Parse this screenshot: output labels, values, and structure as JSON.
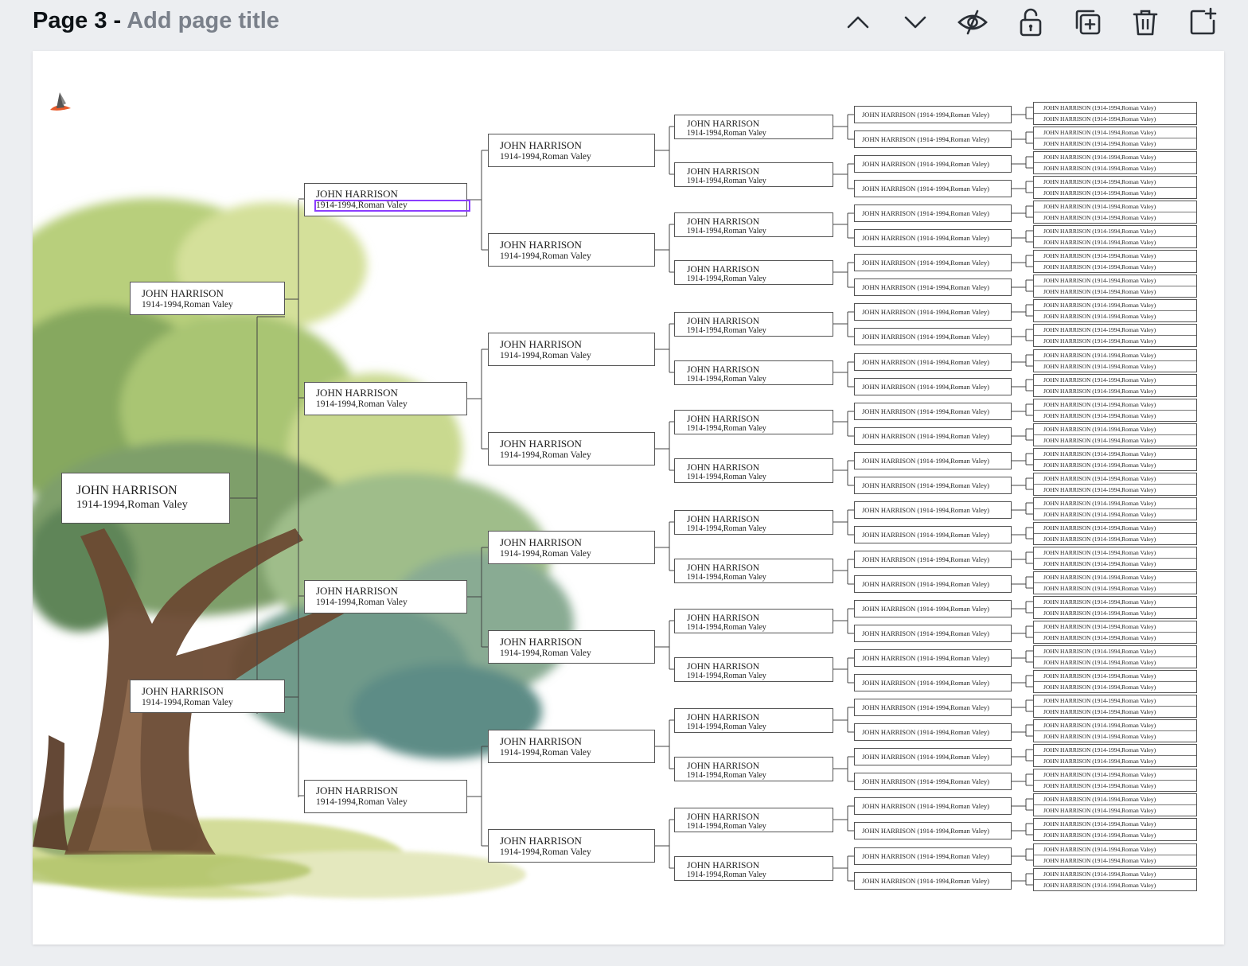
{
  "header": {
    "page_number": "Page 3",
    "separator": " - ",
    "title_placeholder": "Add page title"
  },
  "toolbar": [
    {
      "name": "move-up-icon"
    },
    {
      "name": "move-down-icon"
    },
    {
      "name": "hide-page-icon"
    },
    {
      "name": "lock-page-icon"
    },
    {
      "name": "duplicate-page-icon"
    },
    {
      "name": "delete-page-icon"
    },
    {
      "name": "add-page-icon"
    }
  ],
  "person": {
    "name": "JOHN HARRISON",
    "details": "1914-1994,Roman Valey",
    "compact": "JOHN HARRISON (1914-1994,Roman Valey)"
  },
  "colors": {
    "selection": "#8b3dff",
    "box_border": "#555555",
    "canvas": "#ffffff",
    "workspace": "#eceef1"
  }
}
